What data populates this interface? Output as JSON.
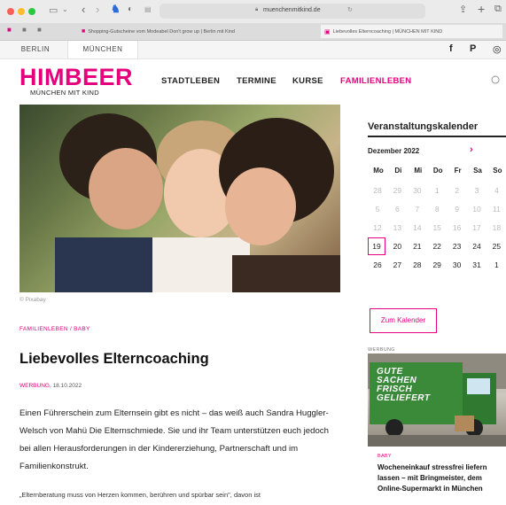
{
  "browser": {
    "url": "muenchenmitkind.de",
    "tabs": [
      {
        "label": "Shopping-Gutscheine vom Modeabel Don't grow up | Berlin mit Kind"
      },
      {
        "label": "Liebevolles Elterncoaching | MÜNCHEN MIT KIND"
      }
    ]
  },
  "cities": [
    "BERLIN",
    "MÜNCHEN"
  ],
  "logo": {
    "brand": "HIMBEER",
    "sub": "MÜNCHEN MIT KIND"
  },
  "nav": [
    "STADTLEBEN",
    "TERMINE",
    "KURSE",
    "FAMILIENLEBEN"
  ],
  "social": {
    "facebook": "f",
    "pinterest": "P",
    "instagram": "◎"
  },
  "article": {
    "photo_credit": "© Pixabay",
    "category": "FAMILIENLEBEN / BABY",
    "title": "Liebevolles Elterncoaching",
    "meta_tag": "WERBUNG",
    "meta_date": ", 18.10.2022",
    "lead": "Einen Führerschein zum Elternsein gibt es nicht – das weiß auch Sandra Huggler-Welsch von Mahü Die Elternschmiede. Sie und ihr Team unterstützen euch jedoch bei allen Herausforderungen in der Kindererziehung, Partnerschaft und im Familienkonstrukt.",
    "quote": "„Elternberatung muss von Herzen kommen, berühren und spürbar sein\", davon ist"
  },
  "calendar": {
    "heading": "Veranstaltungskalender",
    "month": "Dezember 2022",
    "next": "›",
    "weekdays": [
      "Mo",
      "Di",
      "Mi",
      "Do",
      "Fr",
      "Sa",
      "So"
    ],
    "rows": [
      [
        "28",
        "29",
        "30",
        "1",
        "2",
        "3",
        "4"
      ],
      [
        "5",
        "6",
        "7",
        "8",
        "9",
        "10",
        "11"
      ],
      [
        "12",
        "13",
        "14",
        "15",
        "16",
        "17",
        "18"
      ],
      [
        "19",
        "20",
        "21",
        "22",
        "23",
        "24",
        "25"
      ],
      [
        "26",
        "27",
        "28",
        "29",
        "30",
        "31",
        "1"
      ]
    ],
    "today": "19",
    "button": "Zum Kalender"
  },
  "ad": {
    "label": "WERBUNG",
    "truck_text": "GUTE SACHEN FRISCH GELIEFERT",
    "category": "BABY",
    "title": "Wocheneinkauf stressfrei liefern lassen – mit Bringmeister, dem Online-Supermarkt in München"
  },
  "colors": {
    "accent": "#e5007e",
    "text": "#222222"
  }
}
